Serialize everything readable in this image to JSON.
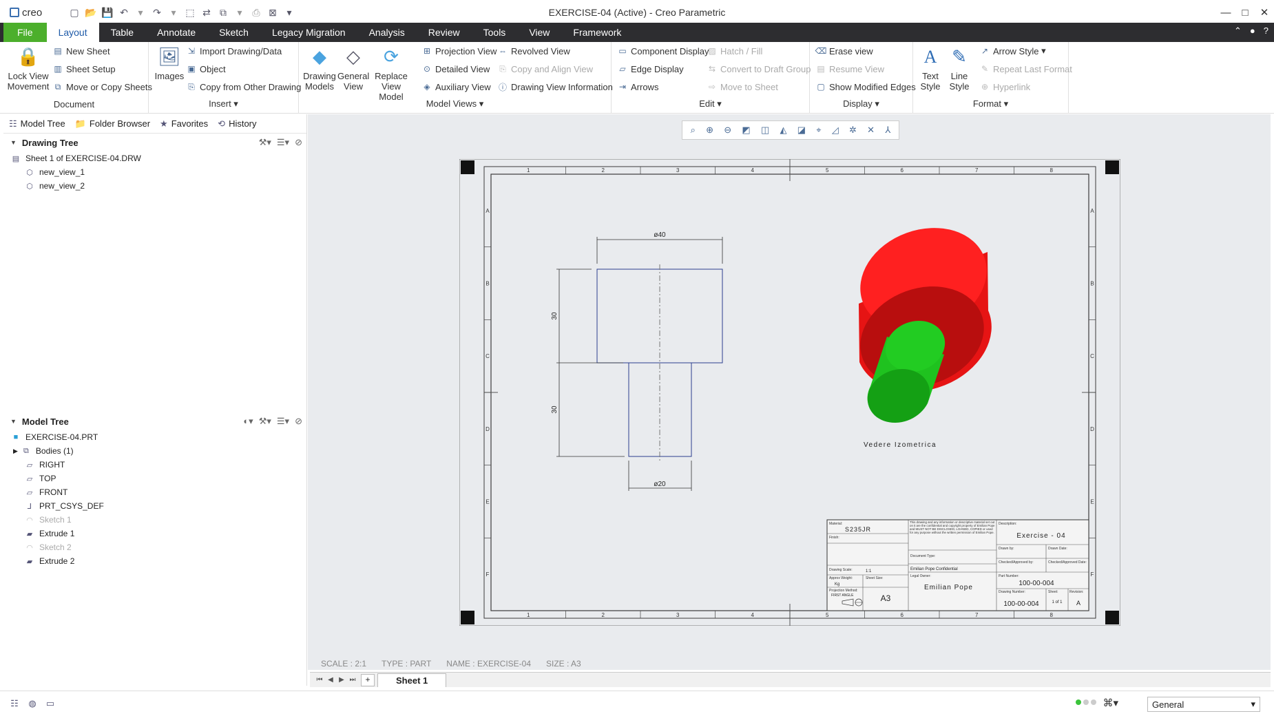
{
  "app": {
    "logo_text": "creo",
    "window_title": "EXERCISE-04 (Active) - Creo Parametric"
  },
  "quick_access": {
    "icons": [
      "new-icon",
      "open-icon",
      "save-icon",
      "undo-icon",
      "redo-icon",
      "select-box-icon",
      "regenerate-icon",
      "windows-icon",
      "close-icon",
      "customize-icon"
    ]
  },
  "menu_tabs": [
    {
      "label": "File"
    },
    {
      "label": "Layout"
    },
    {
      "label": "Table"
    },
    {
      "label": "Annotate"
    },
    {
      "label": "Sketch"
    },
    {
      "label": "Legacy Migration"
    },
    {
      "label": "Analysis"
    },
    {
      "label": "Review"
    },
    {
      "label": "Tools"
    },
    {
      "label": "View"
    },
    {
      "label": "Framework"
    }
  ],
  "ribbon": {
    "document": {
      "label": "Document",
      "lock_view": "Lock View\nMovement",
      "new_sheet": "New Sheet",
      "sheet_setup": "Sheet Setup",
      "move_copy": "Move or Copy Sheets"
    },
    "insert": {
      "label": "Insert",
      "images": "Images",
      "import": "Import Drawing/Data",
      "object": "Object",
      "copy_other": "Copy from Other Drawing"
    },
    "model_views": {
      "label": "Model Views",
      "drawing_models": "Drawing\nModels",
      "general_view": "General\nView",
      "replace_view_model": "Replace\nView Model",
      "projection_view": "Projection View",
      "detailed_view": "Detailed View",
      "auxiliary_view": "Auxiliary View",
      "revolved_view": "Revolved View",
      "copy_align": "Copy and Align View",
      "drawing_view_info": "Drawing View Information"
    },
    "edit": {
      "label": "Edit",
      "component_display": "Component Display",
      "edge_display": "Edge Display",
      "arrows": "Arrows",
      "hatch_fill": "Hatch / Fill",
      "convert_draft": "Convert to Draft Group",
      "move_sheet": "Move to Sheet"
    },
    "display": {
      "label": "Display",
      "erase_view": "Erase view",
      "resume_view": "Resume View",
      "show_modified": "Show Modified Edges"
    },
    "format": {
      "label": "Format",
      "text_style": "Text\nStyle",
      "line_style": "Line\nStyle",
      "arrow_style": "Arrow Style",
      "repeat_last": "Repeat Last Format",
      "hyperlink": "Hyperlink"
    }
  },
  "nav_tabs": [
    "Model Tree",
    "Folder Browser",
    "Favorites",
    "History"
  ],
  "drawing_tree": {
    "title": "Drawing Tree",
    "items": [
      "Sheet 1 of EXERCISE-04.DRW",
      "new_view_1",
      "new_view_2"
    ]
  },
  "model_tree": {
    "title": "Model Tree",
    "items": [
      {
        "label": "EXERCISE-04.PRT",
        "dim": false
      },
      {
        "label": "Bodies (1)",
        "dim": false
      },
      {
        "label": "RIGHT",
        "dim": false
      },
      {
        "label": "TOP",
        "dim": false
      },
      {
        "label": "FRONT",
        "dim": false
      },
      {
        "label": "PRT_CSYS_DEF",
        "dim": false
      },
      {
        "label": "Sketch 1",
        "dim": true
      },
      {
        "label": "Extrude 1",
        "dim": false
      },
      {
        "label": "Sketch 2",
        "dim": true
      },
      {
        "label": "Extrude 2",
        "dim": false
      }
    ]
  },
  "drawing": {
    "zone_numbers": [
      "1",
      "2",
      "3",
      "4",
      "5",
      "6",
      "7",
      "8"
    ],
    "zone_letters": [
      "A",
      "B",
      "C",
      "D",
      "E",
      "F"
    ],
    "dim_diam_top": "ø40",
    "dim_diam_bottom": "ø20",
    "dim_height_top": "30",
    "dim_height_bottom": "30",
    "iso_caption": "Vedere Izometrica",
    "title_block": {
      "material_label": "Material:",
      "material": "S235JR",
      "finish_label": "Finish:",
      "description_label": "Description:",
      "description": "Exercise - 04",
      "notice": "This drawing and any information or descriptive material set out on it are the confidential and copyright property of Emilian Pope and MUST NOT BE DISCLOSED, LOANED, COPIED or used for any purpose without the written permission of Emilian Pope.",
      "drawn_by": "Drawn by:",
      "drawn_date": "Drawn Date:",
      "checked_by": "Checked/Approved by:",
      "checked_date": "Checked/Approved Date:",
      "doc_type": "Document Type:",
      "confidential": "Emilian Pope Confidential",
      "legal_owner_label": "Legal Owner:",
      "legal_owner": "Emilian Pope",
      "part_number_label": "Part Number:",
      "part_number": "100-00-004",
      "drawing_number_label": "Drawing Number:",
      "drawing_number": "100-00-004",
      "sheet_size_label": "Sheet Size:",
      "sheet_size": "A3",
      "sheet_label": "Sheet:",
      "sheet": "1 of 1",
      "revision_label": "Revision:",
      "revision": "A",
      "scale_label": "Drawing Scale:",
      "scale": "1:1",
      "weight_label": "Approx Weight:",
      "weight": "Kg",
      "projection_label": "Projection Method:",
      "projection": "FIRST ANGLE"
    }
  },
  "view_toolbar_icons": [
    "refit-icon",
    "zoom-in-icon",
    "zoom-out-icon",
    "repaint-icon",
    "display-style-icon",
    "saved-views-icon",
    "view-manager-icon",
    "datum-display-icon",
    "annotation-display-icon",
    "spin-center-icon",
    "csys-display-icon",
    "point-display-icon"
  ],
  "status_line": {
    "scale": "SCALE : 2:1",
    "type": "TYPE : PART",
    "name": "NAME : EXERCISE-04",
    "size": "SIZE : A3"
  },
  "sheet_tabs": {
    "add": "+",
    "active": "Sheet 1"
  },
  "bottom": {
    "filter": "General"
  },
  "colors": {
    "file_tab": "#4caf2c",
    "tab_bar": "#2d2d30",
    "canvas": "#e9ebee",
    "part_red": "#ee1c1c",
    "part_green": "#22cc22",
    "drawing_line": "#2a3e8f"
  }
}
